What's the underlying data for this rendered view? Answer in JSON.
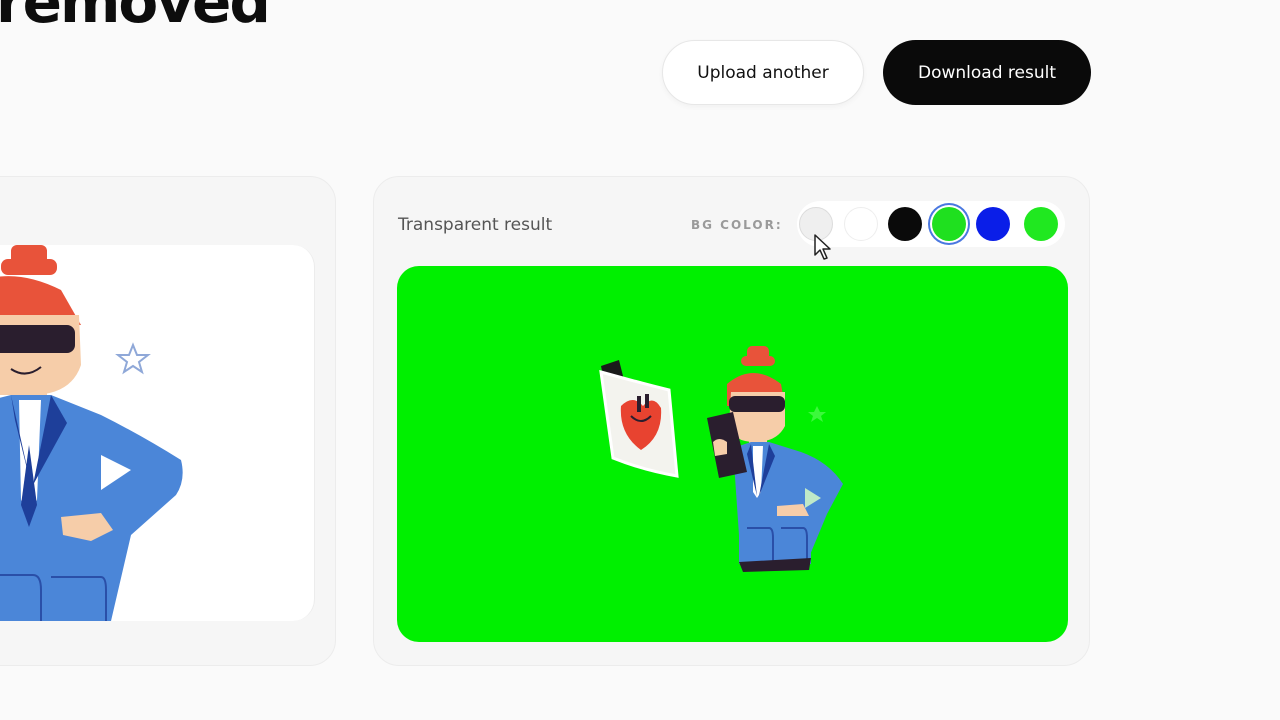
{
  "header": {
    "title": "removed"
  },
  "actions": {
    "upload_another_label": "Upload another",
    "download_result_label": "Download result"
  },
  "result_panel": {
    "label": "Transparent result",
    "bg_color_label": "BG COLOR:",
    "selected_background": "#00f000",
    "swatches": [
      {
        "name": "transparent",
        "color": "transparent"
      },
      {
        "name": "white",
        "color": "#ffffff"
      },
      {
        "name": "black",
        "color": "#0a0a0a"
      },
      {
        "name": "green",
        "color": "#1fe01f",
        "selected": true
      },
      {
        "name": "blue",
        "color": "#0a1ee8"
      },
      {
        "name": "bright-green",
        "color": "#20e820"
      }
    ]
  },
  "colors": {
    "primary_button": "#0a0a0a",
    "accent_selected_ring": "#4a78e0",
    "hair": "#e8533a",
    "suit": "#4b86d8",
    "suit_dark": "#1e3f9a",
    "visor": "#2a1e2e",
    "skin": "#f6cda9"
  }
}
